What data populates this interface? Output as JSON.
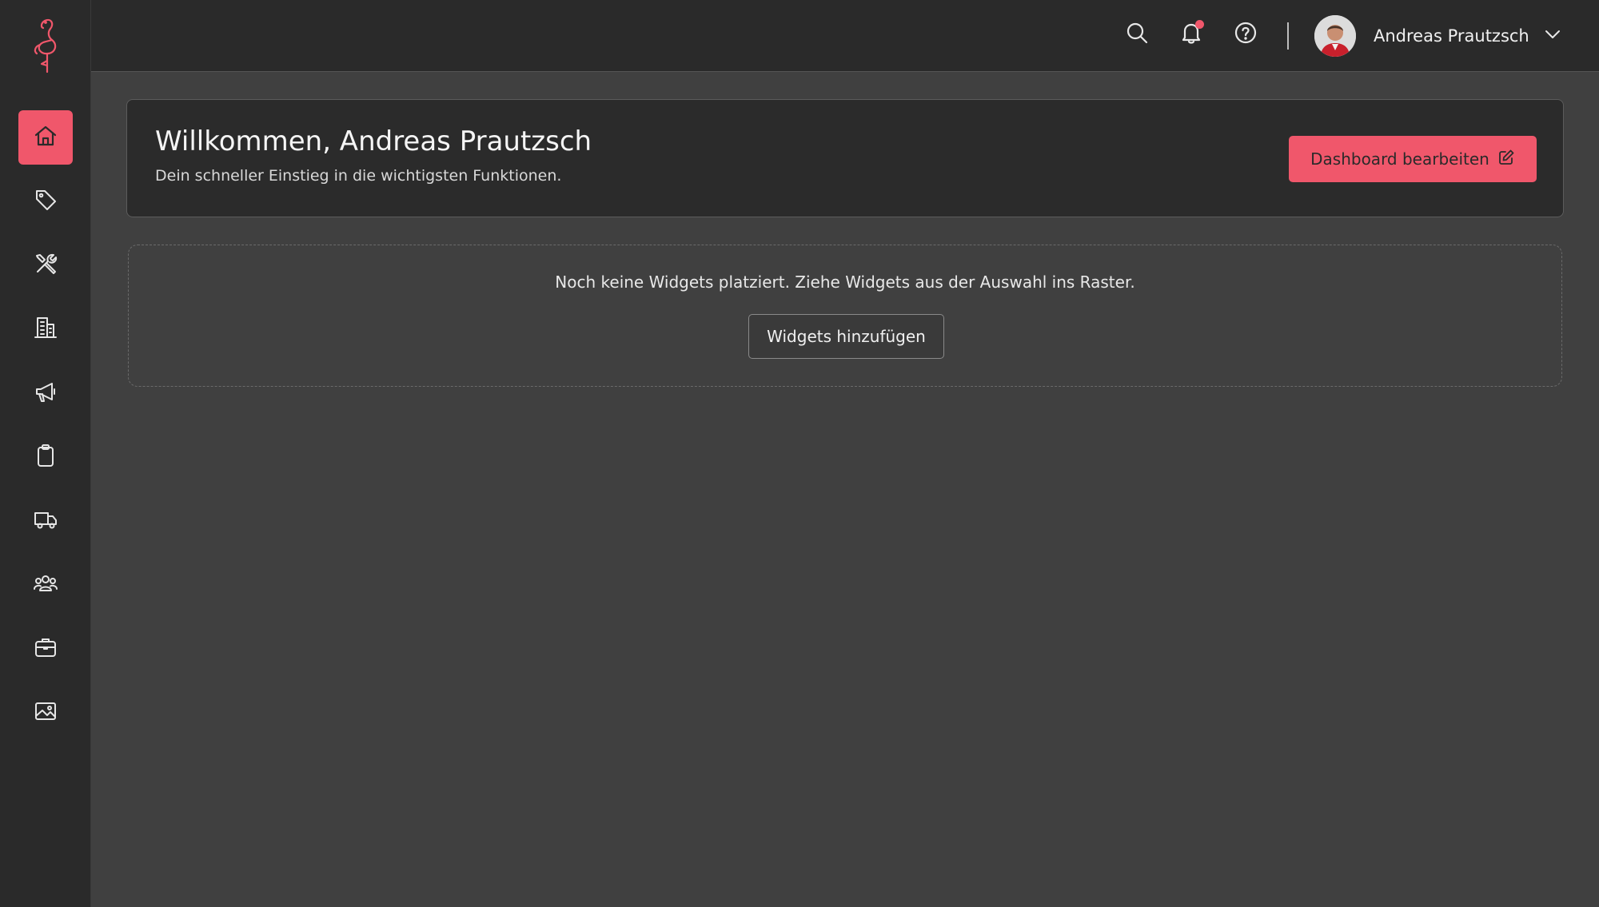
{
  "colors": {
    "accent": "#f0576b",
    "sidebar_bg": "#2a2a2a",
    "page_bg": "#404040"
  },
  "sidebar": {
    "logo_icon": "flamingo-logo",
    "items": [
      {
        "icon": "home-icon",
        "active": true
      },
      {
        "icon": "tag-icon",
        "active": false
      },
      {
        "icon": "tools-icon",
        "active": false
      },
      {
        "icon": "building-icon",
        "active": false
      },
      {
        "icon": "megaphone-icon",
        "active": false
      },
      {
        "icon": "clipboard-icon",
        "active": false
      },
      {
        "icon": "truck-icon",
        "active": false
      },
      {
        "icon": "users-icon",
        "active": false
      },
      {
        "icon": "briefcase-icon",
        "active": false
      },
      {
        "icon": "image-icon",
        "active": false
      }
    ]
  },
  "topbar": {
    "icons": [
      "search-icon",
      "bell-icon",
      "help-icon"
    ],
    "notification_dot": true,
    "user_name": "Andreas Prautzsch"
  },
  "welcome": {
    "title": "Willkommen, Andreas Prautzsch",
    "subtitle": "Dein schneller Einstieg in die wichtigsten Funktionen.",
    "edit_button": "Dashboard bearbeiten"
  },
  "widgets": {
    "empty_text": "Noch keine Widgets platziert. Ziehe Widgets aus der Auswahl ins Raster.",
    "add_button": "Widgets hinzufügen"
  }
}
